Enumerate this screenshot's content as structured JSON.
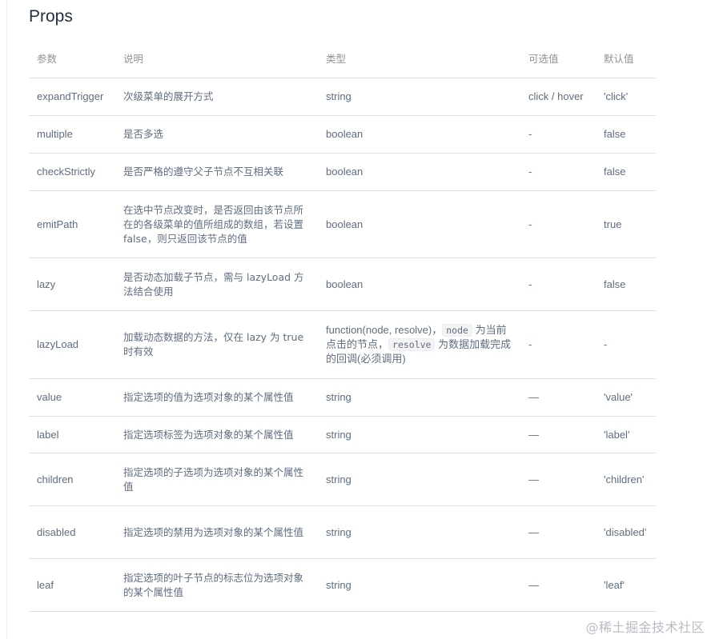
{
  "title": "Props",
  "table": {
    "headers": {
      "param": "参数",
      "desc": "说明",
      "type": "类型",
      "options": "可选值",
      "default": "默认值"
    },
    "rows": [
      {
        "height": 47,
        "name": "expandTrigger",
        "desc": "次级菜单的展开方式",
        "type": "string",
        "options": "click / hover",
        "default": "'click'"
      },
      {
        "height": 47,
        "name": "multiple",
        "desc": "是否多选",
        "type": "boolean",
        "options": "-",
        "default": "false"
      },
      {
        "height": 47,
        "name": "checkStrictly",
        "desc": "是否严格的遵守父子节点不互相关联",
        "type": "boolean",
        "options": "-",
        "default": "false"
      },
      {
        "height": 84,
        "name": "emitPath",
        "desc": "在选中节点改变时，是否返回由该节点所在的各级菜单的值所组成的数组，若设置 false，则只返回该节点的值",
        "type": "boolean",
        "options": "-",
        "default": "true"
      },
      {
        "height": 66,
        "name": "lazy",
        "desc": "是否动态加载子节点，需与 lazyLoad 方法结合使用",
        "type": "boolean",
        "options": "-",
        "default": "false"
      },
      {
        "height": 85,
        "name": "lazyLoad",
        "desc": "加载动态数据的方法，仅在 lazy 为 true 时有效",
        "type": {
          "pre": "function(node, resolve)，",
          "code1": "node",
          "mid": " 为当前点击的节点，",
          "code2": "resolve",
          "post": " 为数据加载完成的回调(必须调用)"
        },
        "options": "-",
        "default": "-"
      },
      {
        "height": 47,
        "name": "value",
        "desc": "指定选项的值为选项对象的某个属性值",
        "type": "string",
        "options": "—",
        "default": "'value'"
      },
      {
        "height": 46,
        "name": "label",
        "desc": "指定选项标签为选项对象的某个属性值",
        "type": "string",
        "options": "—",
        "default": "'label'"
      },
      {
        "height": 66,
        "name": "children",
        "desc": "指定选项的子选项为选项对象的某个属性值",
        "type": "string",
        "options": "—",
        "default": "'children'"
      },
      {
        "height": 66,
        "name": "disabled",
        "desc": "指定选项的禁用为选项对象的某个属性值",
        "type": "string",
        "options": "—",
        "default": "'disabled'"
      },
      {
        "height": 66,
        "name": "leaf",
        "desc": "指定选项的叶子节点的标志位为选项对象的某个属性值",
        "type": "string",
        "options": "—",
        "default": "'leaf'"
      }
    ]
  },
  "watermark": "@稀土掘金技术社区"
}
